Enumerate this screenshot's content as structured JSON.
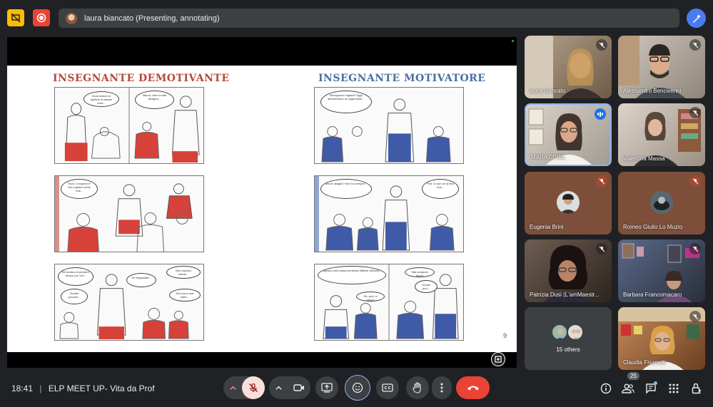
{
  "presenter_bar": {
    "text": "laura biancato (Presenting, annotating)"
  },
  "slide": {
    "left_title": "INSEGNANTE DEMOTIVANTE",
    "right_title": "INSEGNANTE MOTIVATORE",
    "page_number": "9",
    "left_color": "#b5493a",
    "right_color": "#4a6fa0"
  },
  "participants": [
    {
      "name": "laura biancato",
      "muted": true
    },
    {
      "name": "Alessandro Bencivenni",
      "muted": true
    },
    {
      "name": "MARA CINEL",
      "speaking": true
    },
    {
      "name": "Valentina Massa",
      "muted": true
    },
    {
      "name": "Eugenia Brini",
      "muted": true
    },
    {
      "name": "Romeo Giulio Lo Muzio",
      "muted": true
    },
    {
      "name": "Patrizia Dusi (L'amMaestr...",
      "muted": true
    },
    {
      "name": "Barbara Francomacaro",
      "muted": true
    },
    {
      "name": "15 others"
    },
    {
      "name": "Claudia Fisanotti",
      "muted": true
    }
  ],
  "bottom": {
    "time": "18:41",
    "separator": "|",
    "meeting_name": "ELP MEET UP- Vita da Prof",
    "participant_count": "25"
  },
  "colors": {
    "end_call": "#ea4335",
    "mic_off_bg": "#f9dedc",
    "accent": "#8ab4f8"
  }
}
